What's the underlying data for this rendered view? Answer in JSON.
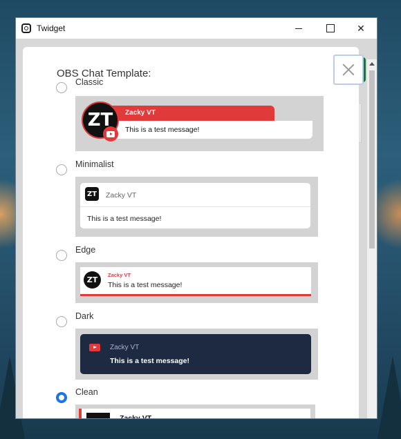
{
  "window": {
    "title": "Twidget"
  },
  "modal": {
    "heading": "OBS Chat Template:",
    "options": [
      {
        "label": "Classic",
        "selected": false
      },
      {
        "label": "Minimalist",
        "selected": false
      },
      {
        "label": "Edge",
        "selected": false
      },
      {
        "label": "Dark",
        "selected": false
      },
      {
        "label": "Clean",
        "selected": true
      }
    ]
  },
  "preview": {
    "username": "Zacky VT",
    "message": "This is a test message!",
    "avatar_initials": "ZT"
  },
  "icons": {
    "platform": "youtube-icon",
    "close": "close-icon"
  },
  "colors": {
    "accent_red": "#e03a3a",
    "dark_card": "#1e2a42",
    "selected_radio": "#1a73e8"
  }
}
